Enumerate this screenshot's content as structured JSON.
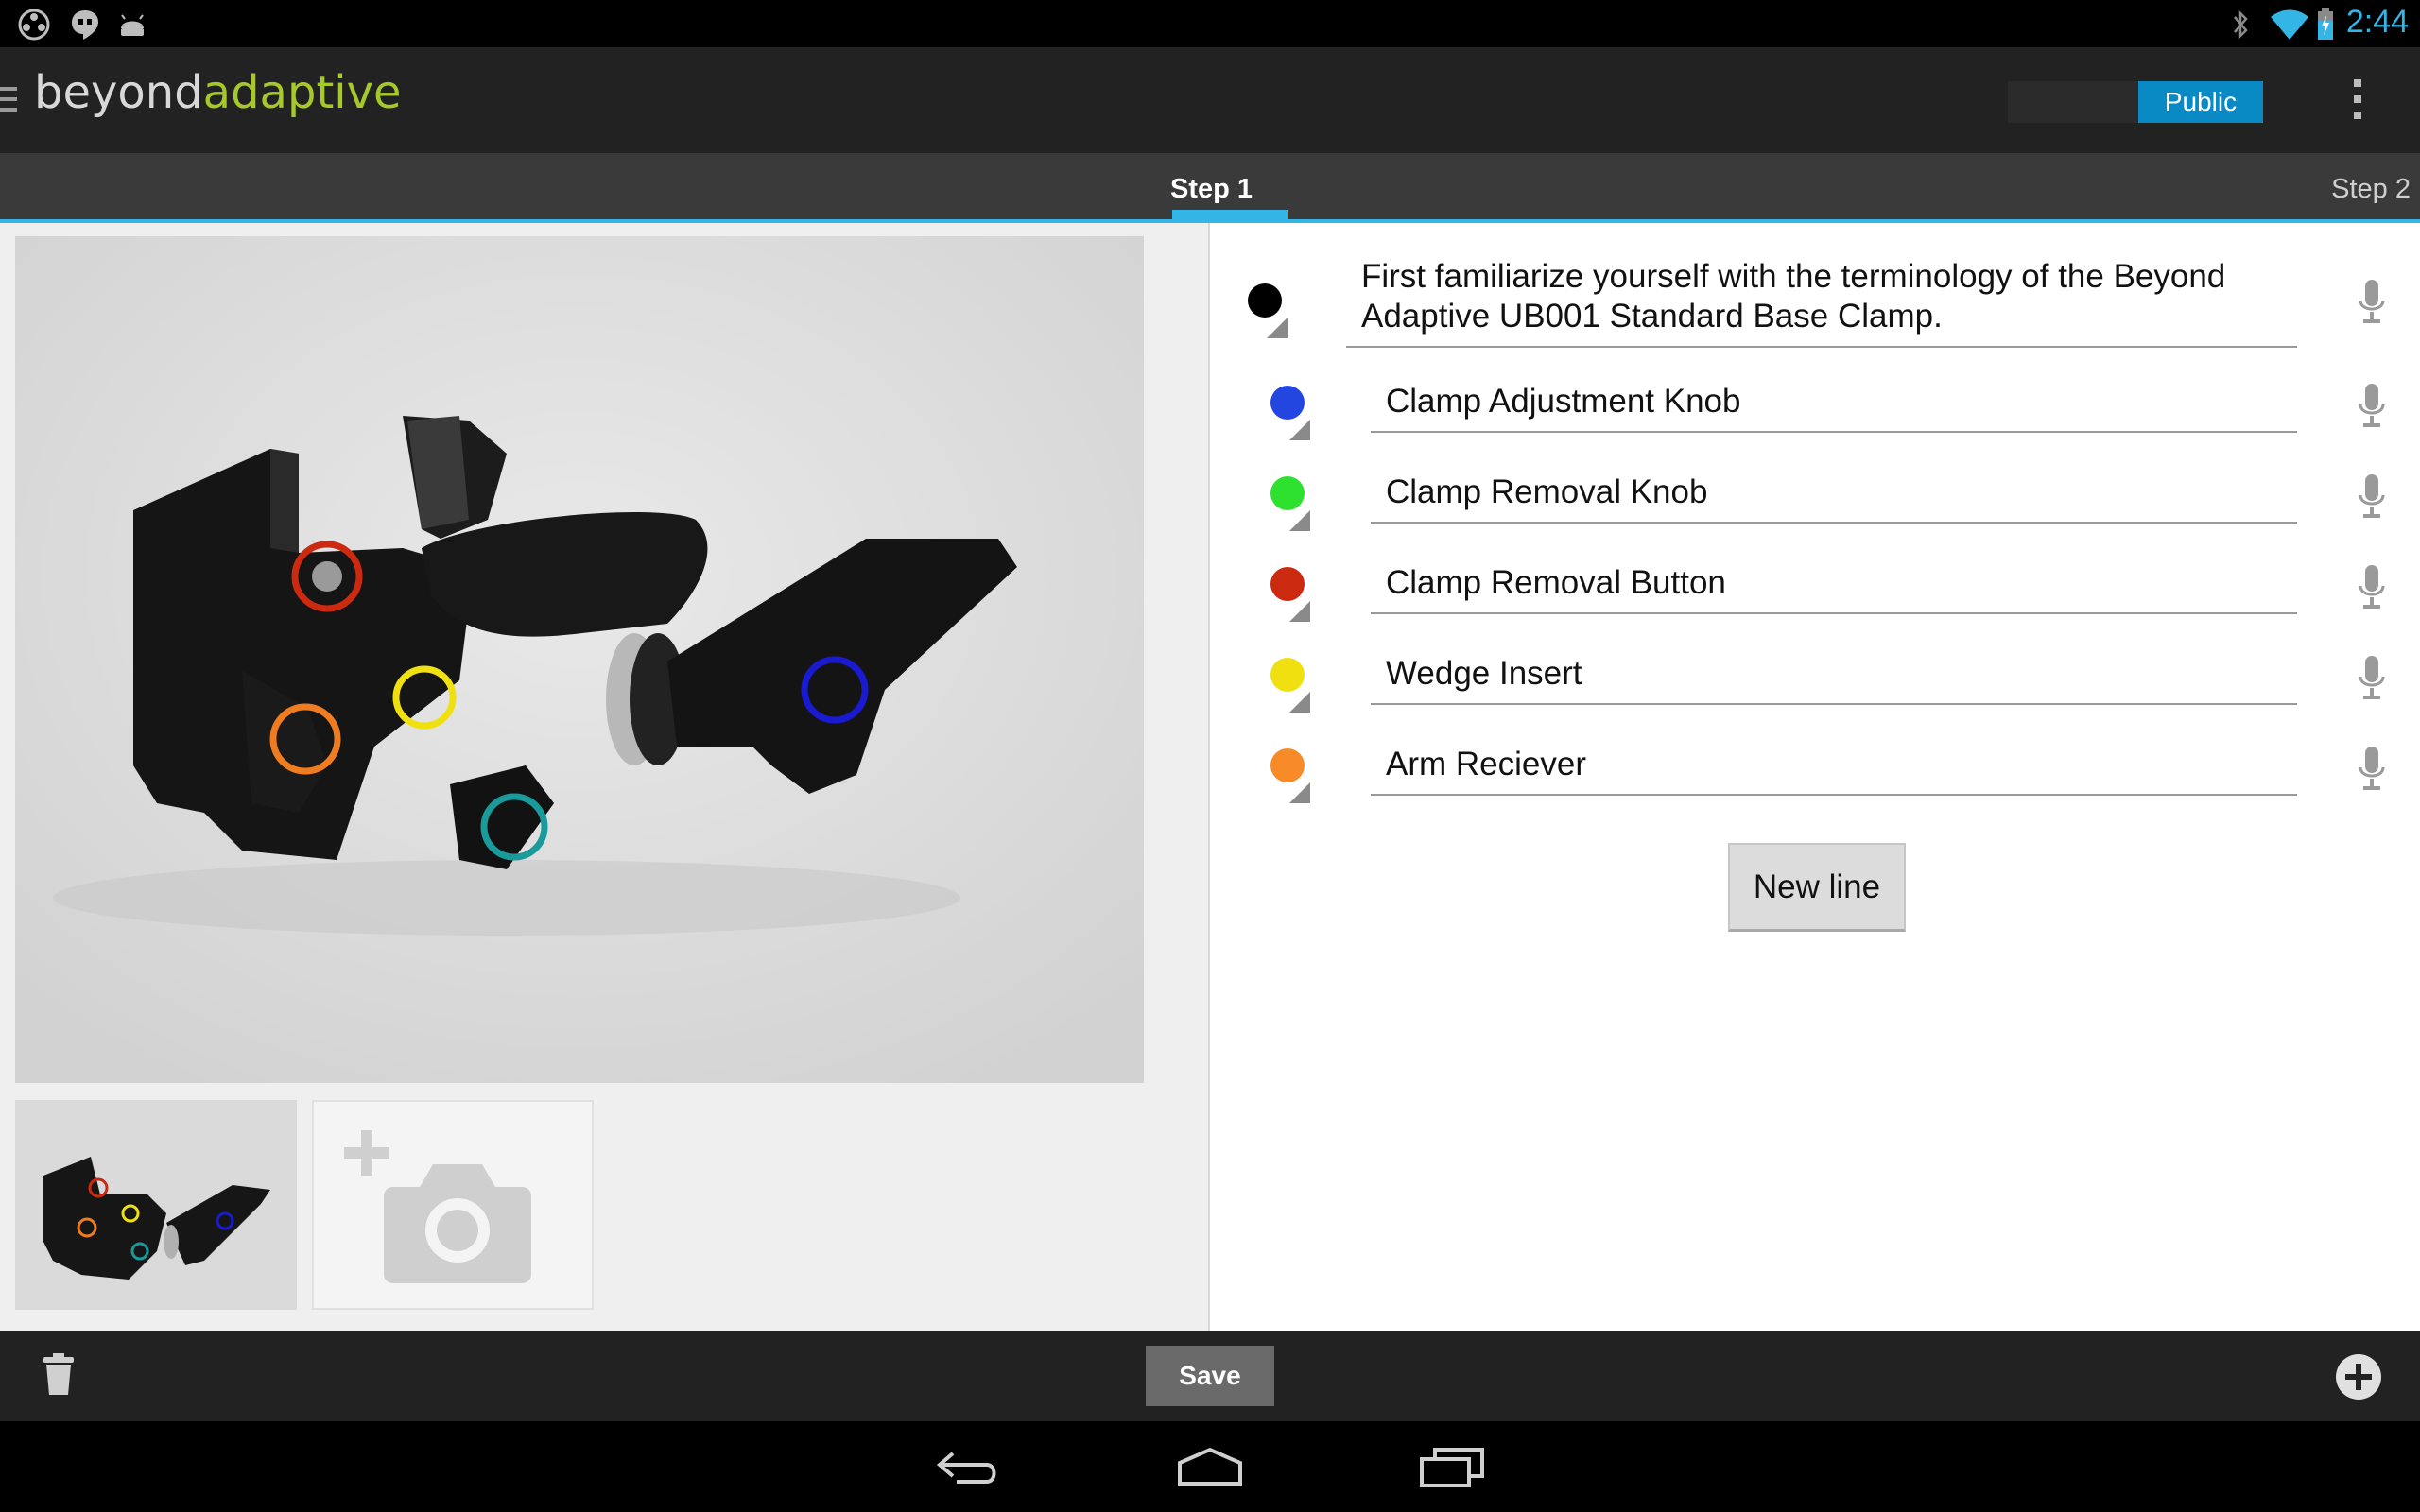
{
  "status_bar": {
    "time": "2:44",
    "left_icons": [
      "film-reel-icon",
      "hangouts-icon",
      "android-icon"
    ],
    "right_icons": [
      "bluetooth-icon",
      "wifi-icon",
      "battery-charging-icon"
    ]
  },
  "action_bar": {
    "logo_part1": "beyond",
    "logo_part2": "adaptive",
    "logo_colors": {
      "part1": "#d8d8d8",
      "part2": "#a6c82b"
    },
    "visibility_label": "Public",
    "accent": "#0a8ac4"
  },
  "tabs": {
    "active": "Step 1",
    "next": "Step 2"
  },
  "steps": {
    "description": "First familiarize yourself with the terminology of the Beyond Adaptive UB001 Standard Base Clamp.",
    "description_color": "#000000",
    "lines": [
      {
        "color": "#2446e0",
        "label": "Clamp Adjustment Knob"
      },
      {
        "color": "#2fe12f",
        "label": "Clamp Removal Knob"
      },
      {
        "color": "#cc2a10",
        "label": "Clamp Removal Button"
      },
      {
        "color": "#f0e010",
        "label": "Wedge Insert"
      },
      {
        "color": "#f88a28",
        "label": "Arm Reciever"
      }
    ],
    "new_line_label": "New line"
  },
  "photo": {
    "markers": [
      {
        "color": "#cc2a10"
      },
      {
        "color": "#f0e010"
      },
      {
        "color": "#f07c20"
      },
      {
        "color": "#1a9a9a"
      },
      {
        "color": "#1a1ad0"
      }
    ]
  },
  "bottom_bar": {
    "save_label": "Save"
  }
}
